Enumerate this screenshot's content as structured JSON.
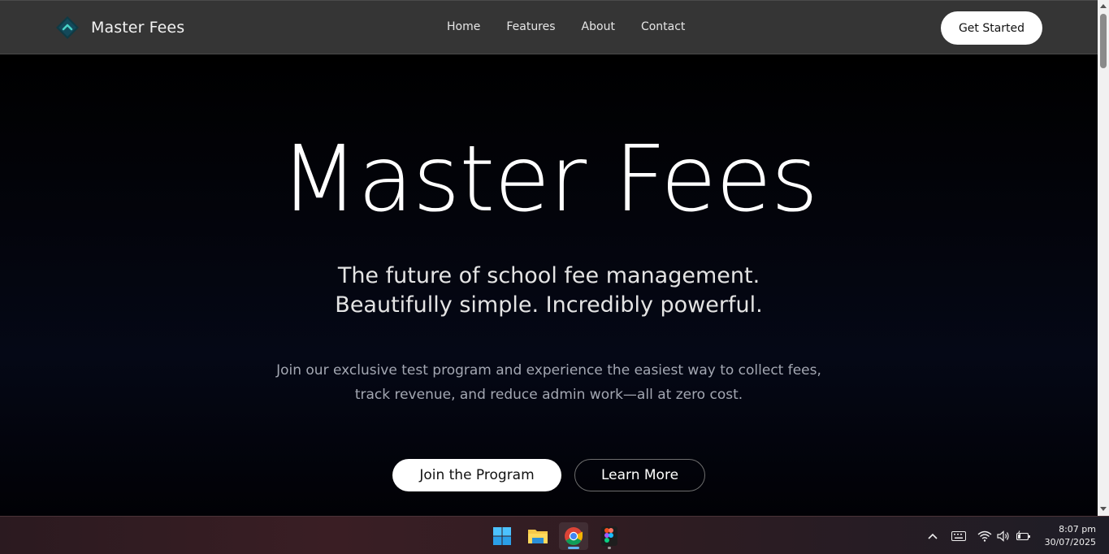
{
  "brand": {
    "name": "Master Fees"
  },
  "nav": {
    "links": [
      {
        "label": "Home"
      },
      {
        "label": "Features"
      },
      {
        "label": "About"
      },
      {
        "label": "Contact"
      }
    ],
    "cta_label": "Get Started"
  },
  "hero": {
    "title": "Master Fees",
    "subtitle_line1": "The future of school fee management.",
    "subtitle_line2": "Beautifully simple. Incredibly powerful.",
    "description_line1": "Join our exclusive test program and experience the easiest way to collect fees,",
    "description_line2": "track revenue, and reduce admin work—all at zero cost.",
    "primary_button": "Join the Program",
    "secondary_button": "Learn More"
  },
  "taskbar": {
    "apps": [
      {
        "name": "windows-start-icon"
      },
      {
        "name": "file-explorer-icon"
      },
      {
        "name": "chrome-icon"
      },
      {
        "name": "figma-icon"
      }
    ],
    "time": "8:07 pm",
    "date": "30/07/2025"
  },
  "colors": {
    "navbar_bg": "#353535",
    "hero_bg": "#000000",
    "logo_accent": "#2fb6b0",
    "logo_dark": "#0f2f3a"
  }
}
